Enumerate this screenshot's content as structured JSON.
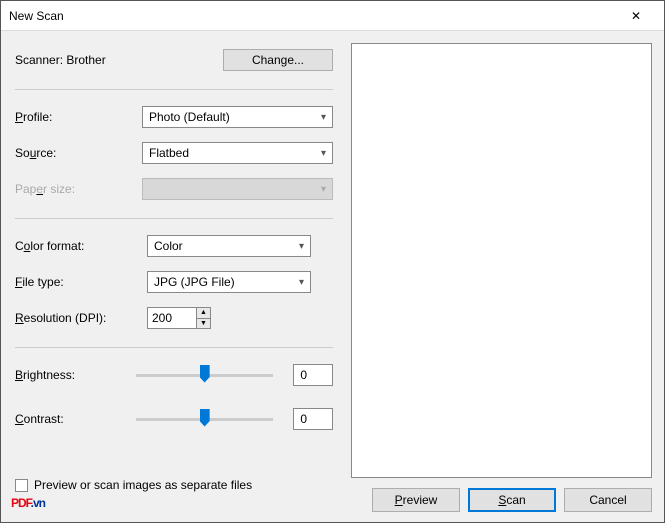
{
  "window": {
    "title": "New Scan"
  },
  "scanner": {
    "label_prefix": "Scanner: ",
    "name": "Brother",
    "change_btn": "Change..."
  },
  "fields": {
    "profile_label": "Profile:",
    "profile_value": "Photo (Default)",
    "source_label": "Source:",
    "source_value": "Flatbed",
    "papersize_label": "Paper size:",
    "papersize_value": "",
    "colorformat_label": "Color format:",
    "colorformat_value": "Color",
    "filetype_label": "File type:",
    "filetype_value": "JPG (JPG File)",
    "resolution_label": "Resolution (DPI):",
    "resolution_value": "200",
    "brightness_label": "Brightness:",
    "brightness_value": "0",
    "contrast_label": "Contrast:",
    "contrast_value": "0"
  },
  "checkbox": {
    "label": "Preview or scan images as separate files"
  },
  "buttons": {
    "preview": "Preview",
    "scan": "Scan",
    "cancel": "Cancel"
  },
  "watermark": {
    "red": "PDF",
    "blue": ".vn"
  }
}
